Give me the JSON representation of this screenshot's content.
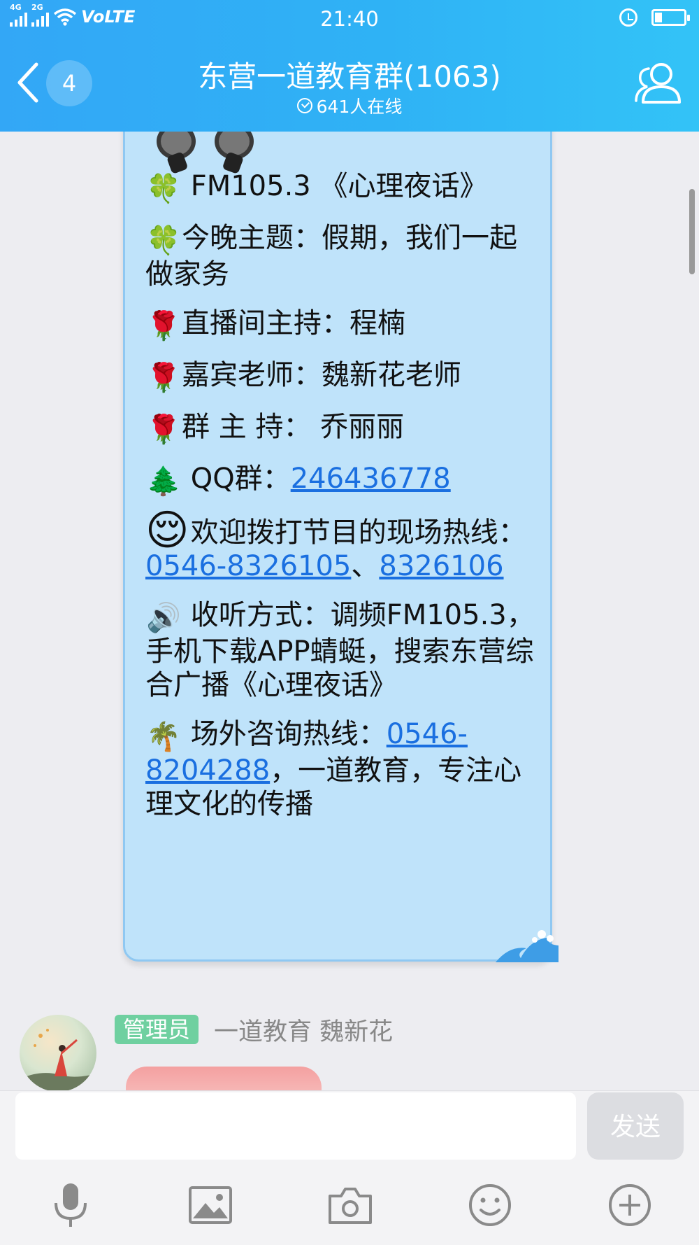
{
  "status_bar": {
    "net1": "4G",
    "net2": "2G",
    "volte": "VoLTE",
    "time": "21:40"
  },
  "header": {
    "unread_count": "4",
    "title": "东营一道教育群(1063)",
    "online": "641人在线"
  },
  "message": {
    "lines": [
      {
        "emoji": "🍀",
        "pre": " FM105.3 《心理夜话》",
        "link": "",
        "post": ""
      },
      {
        "emoji": "🍀",
        "pre": "今晚主题：假期，我们一起做家务",
        "link": "",
        "post": ""
      },
      {
        "emoji": "🌹",
        "pre": "直播间主持：程楠",
        "link": "",
        "post": ""
      },
      {
        "emoji": "🌹",
        "pre": "嘉宾老师：魏新花老师",
        "link": "",
        "post": ""
      },
      {
        "emoji": "🌹",
        "pre": "群 主 持：  乔丽丽",
        "link": "",
        "post": ""
      },
      {
        "emoji": "🌲",
        "pre": " QQ群：",
        "link": "246436778",
        "post": ""
      },
      {
        "emoji": "😌",
        "pre": " 欢迎拨打节目的现场热线：",
        "link": "0546-8326105",
        "post": "、",
        "link2": "8326106"
      },
      {
        "emoji": "🔊",
        "pre": " 收听方式：调频FM105.3，手机下载APP蜻蜓，搜索东营综合广播《心理夜话》",
        "link": "",
        "post": ""
      },
      {
        "emoji": "🌴",
        "pre": " 场外咨询热线：",
        "link": "0546-8204288",
        "post": "，一道教育，专注心理文化的传播"
      }
    ]
  },
  "next_message": {
    "badge": "管理员",
    "sender": "一道教育 魏新花"
  },
  "input": {
    "placeholder": "",
    "send_label": "发送"
  },
  "toolbar": [
    "mic-icon",
    "image-icon",
    "camera-icon",
    "emoji-icon",
    "plus-icon"
  ],
  "colors": {
    "header_blue": "#2fb2f5",
    "bubble_blue": "#bfe3fa",
    "link_blue": "#1a6fe0",
    "admin_green": "#6fd0a0"
  }
}
